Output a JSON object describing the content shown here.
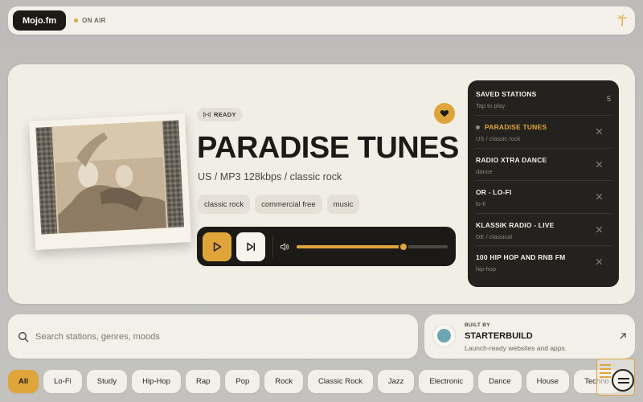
{
  "topbar": {
    "brand": "Mojo.fm",
    "status": "ON AIR",
    "logo_icon": "palm-tree-icon"
  },
  "now_playing": {
    "status": "READY",
    "title": "PARADISE TUNES",
    "meta": "US / MP3 128kbps / classic rock",
    "tags": [
      "classic rock",
      "commercial free",
      "music"
    ],
    "favorited": true,
    "volume": 0.71
  },
  "saved": {
    "title": "SAVED STATIONS",
    "subtitle": "Tap to play",
    "count": "5",
    "stations": [
      {
        "name": "PARADISE TUNES",
        "meta": "US / classic rock",
        "active": true
      },
      {
        "name": "RADIO XTRA DANCE",
        "meta": "dance",
        "active": false
      },
      {
        "name": "OR - LO-FI",
        "meta": "lo-fi",
        "active": false
      },
      {
        "name": "KLASSIK RADIO - LIVE",
        "meta": "DE / classical",
        "active": false
      },
      {
        "name": "100 HIP HOP AND RNB FM",
        "meta": "hip-hop",
        "active": false
      }
    ]
  },
  "search": {
    "placeholder": "Search stations, genres, moods"
  },
  "builtby": {
    "label": "BUILT BY",
    "name": "STARTERBUILD",
    "tagline": "Launch-ready websites and apps."
  },
  "genres": [
    "All",
    "Lo-Fi",
    "Study",
    "Hip-Hop",
    "Rap",
    "Pop",
    "Rock",
    "Classic Rock",
    "Jazz",
    "Electronic",
    "Dance",
    "House",
    "Techno"
  ],
  "colors": {
    "accent": "#e0a53a",
    "dark": "#1c1a17",
    "card": "#f1eee6"
  }
}
